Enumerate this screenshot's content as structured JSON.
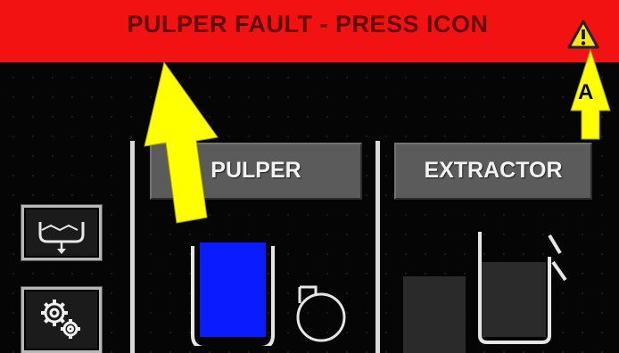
{
  "banner": {
    "message": "PULPER FAULT - PRESS ICON",
    "color": "#f31212",
    "icon": "warning-triangle-icon"
  },
  "tabs": [
    {
      "label": "PULPER"
    },
    {
      "label": "EXTRACTOR"
    }
  ],
  "side_buttons": [
    {
      "icon": "drain-tank-icon"
    },
    {
      "icon": "gears-icon"
    }
  ],
  "callout": {
    "label": "A"
  },
  "pulper_tank": {
    "fill_color": "#0a1cff"
  },
  "annotation_color": "#ffff00"
}
